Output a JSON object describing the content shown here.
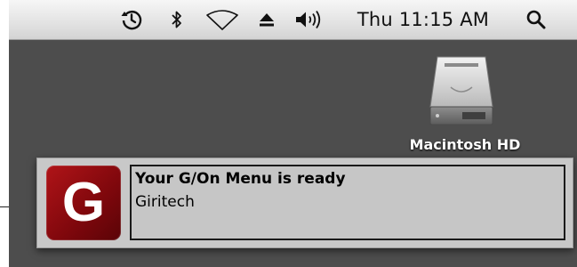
{
  "menubar": {
    "icons": [
      "time-machine-icon",
      "bluetooth-icon",
      "wifi-icon",
      "eject-icon",
      "volume-icon",
      "spotlight-icon"
    ],
    "clock": "Thu 11:15 AM"
  },
  "desktop": {
    "items": [
      {
        "label": "Macintosh HD",
        "icon": "hard-drive-icon"
      }
    ]
  },
  "notification": {
    "app_icon_letter": "G",
    "title": "Your G/On Menu is ready",
    "body": "Giritech",
    "colors": {
      "icon_red": "#9a0c10",
      "background": "#c8c8c8"
    }
  }
}
